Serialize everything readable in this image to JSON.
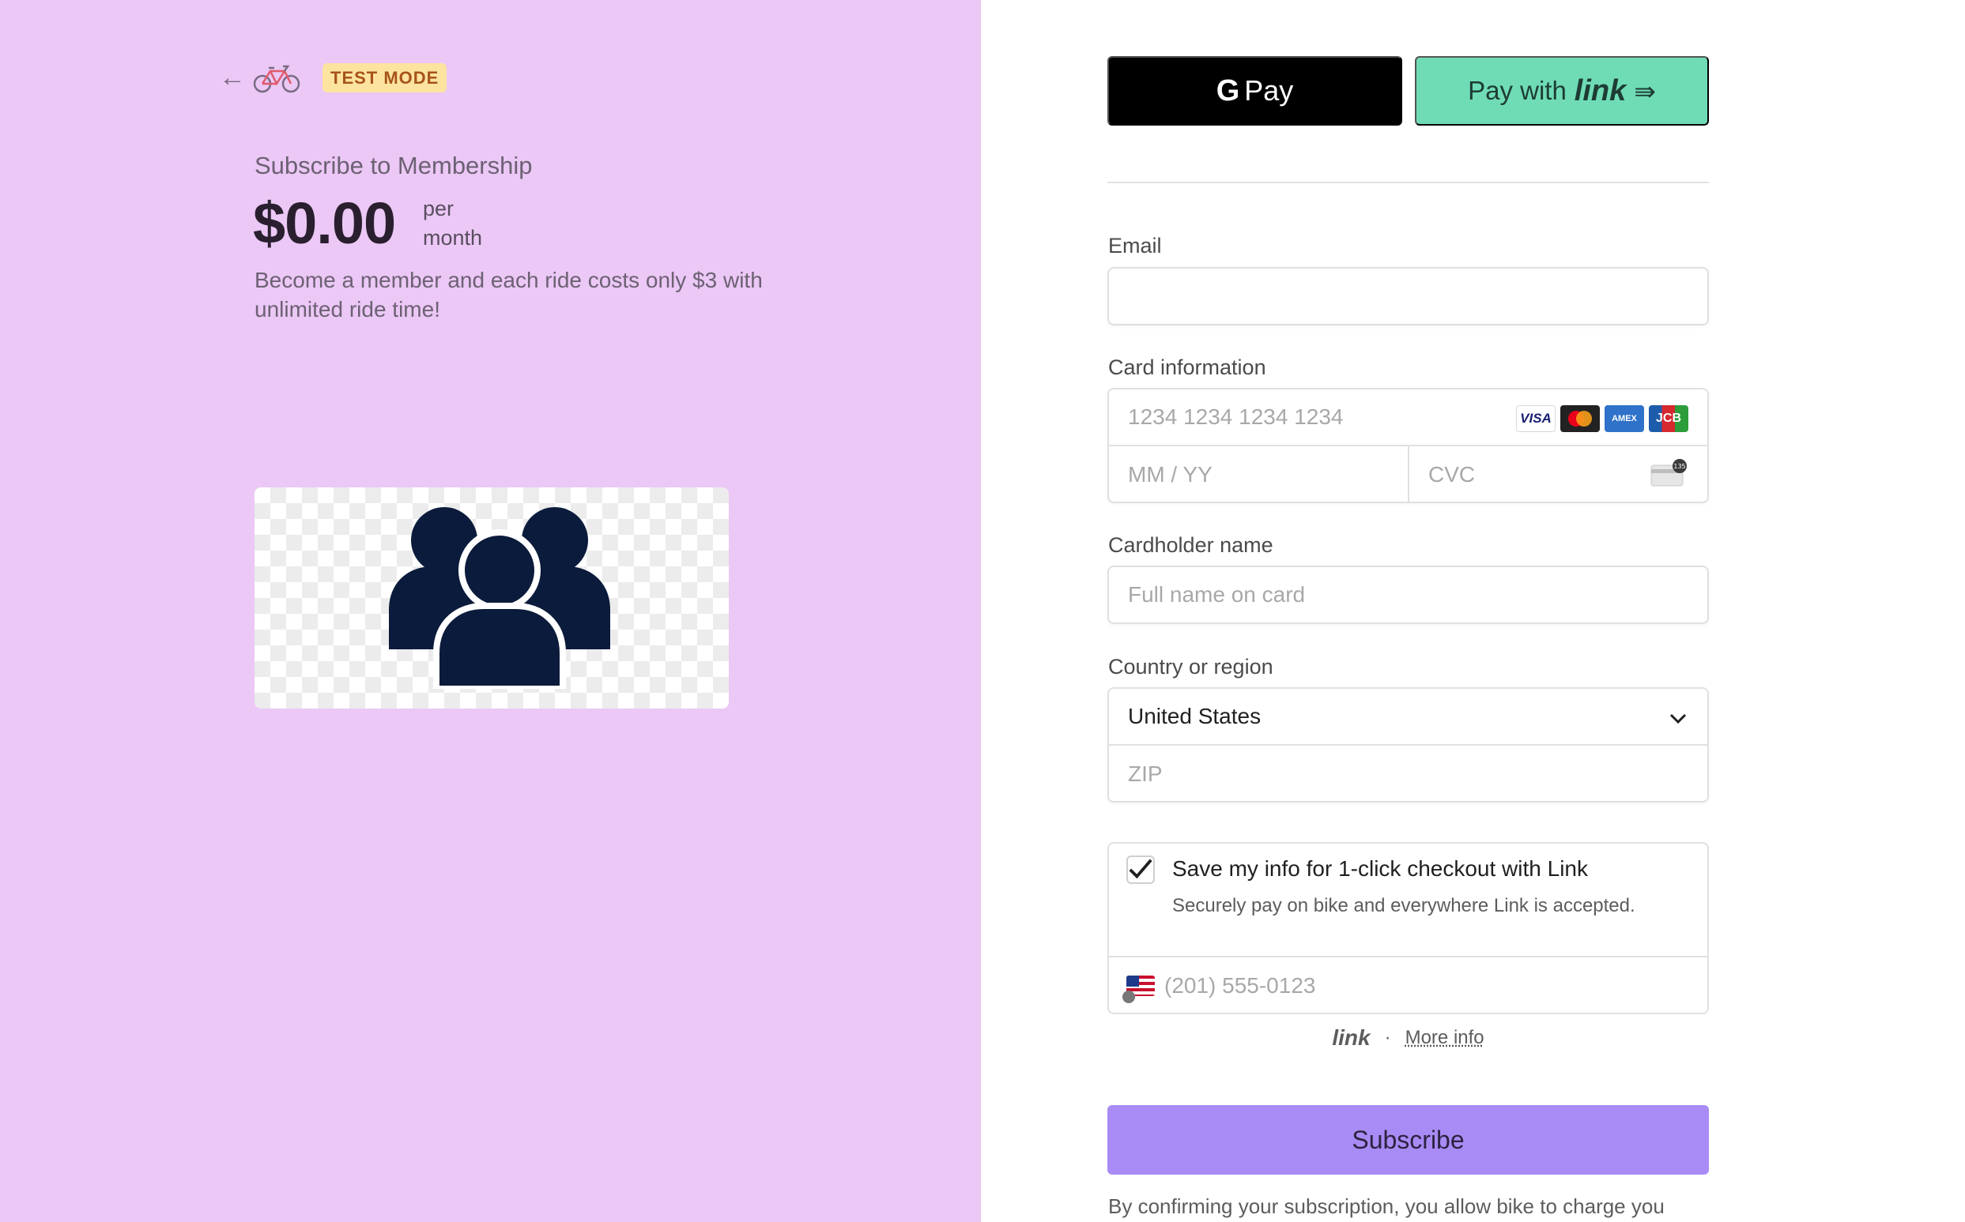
{
  "header": {
    "test_mode_label": "TEST MODE"
  },
  "product": {
    "subscribe_title": "Subscribe to Membership",
    "price": "$0.00",
    "per_line1": "per",
    "per_line2": "month",
    "description": "Become a member and each ride costs only $3 with unlimited ride time!"
  },
  "wallets": {
    "gpay_g": "G",
    "gpay_label": "Pay",
    "link_prefix": "Pay with",
    "link_word": "link",
    "arrow": "⇛"
  },
  "form": {
    "email_label": "Email",
    "email_value": "",
    "card_label": "Card information",
    "card_number_placeholder": "1234 1234 1234 1234",
    "card_brands": [
      "VISA",
      "MC",
      "AMEX",
      "JCB"
    ],
    "expiry_placeholder": "MM / YY",
    "cvc_placeholder": "CVC",
    "cvc_badge": "135",
    "cardholder_label": "Cardholder name",
    "cardholder_placeholder": "Full name on card",
    "country_label": "Country or region",
    "country_value": "United States",
    "zip_placeholder": "ZIP"
  },
  "link_save": {
    "checked": true,
    "title": "Save my info for 1-click checkout with Link",
    "description": "Securely pay on bike and everywhere Link is accepted.",
    "phone_placeholder": "(201) 555-0123",
    "footer_logo": "link",
    "separator": "·",
    "more_info": "More info"
  },
  "actions": {
    "subscribe_label": "Subscribe"
  },
  "terms_text": "By confirming your subscription, you allow bike to charge you",
  "colors": {
    "left_bg": "#ebc8f5",
    "subscribe_bg": "#a98bf5",
    "link_bg": "#6fdcb5",
    "icon_navy": "#0b1b3b"
  },
  "icons": [
    "back-arrow-icon",
    "bicycle-icon",
    "users-group-icon",
    "chevron-down-icon",
    "cvc-card-icon",
    "checkmark-icon",
    "us-flag-icon"
  ]
}
